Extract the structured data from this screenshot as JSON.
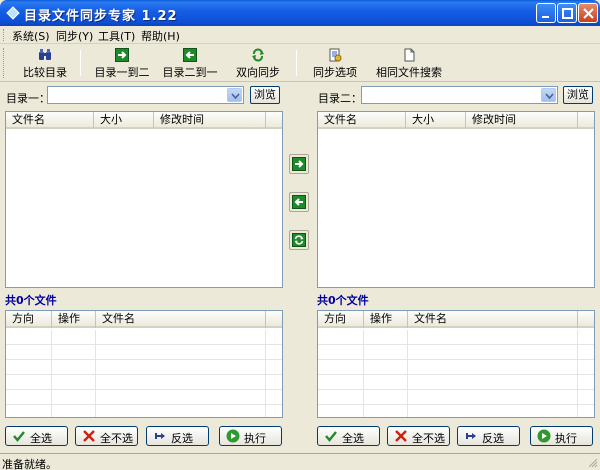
{
  "window": {
    "title": "目录文件同步专家 1.22"
  },
  "menu": [
    "系统(S)",
    "同步(Y)",
    "工具(T)",
    "帮助(H)"
  ],
  "toolbar": {
    "compare": "比较目录",
    "dir1_to_dir2": "目录一到二",
    "dir2_to_dir1": "目录二到一",
    "two_way": "双向同步",
    "sync_options": "同步选项",
    "same_file_search": "相同文件搜索"
  },
  "left": {
    "dir_label": "目录一：",
    "dir_value": "",
    "browse": "浏览",
    "file_columns": [
      "文件名",
      "大小",
      "修改时间"
    ],
    "count": "共0个文件",
    "op_columns": [
      "方向",
      "操作",
      "文件名"
    ]
  },
  "right": {
    "dir_label": "目录二：",
    "dir_value": "",
    "browse": "浏览",
    "file_columns": [
      "文件名",
      "大小",
      "修改时间"
    ],
    "count": "共0个文件",
    "op_columns": [
      "方向",
      "操作",
      "文件名"
    ]
  },
  "buttons": {
    "select_all": "全选",
    "select_none": "全不选",
    "invert": "反选",
    "execute": "执行"
  },
  "status": {
    "text": "准备就绪。"
  },
  "colors": {
    "title_bar": "#0d4fd6",
    "count_text": "#0000a0",
    "icon_green": "#1f8a2a"
  }
}
